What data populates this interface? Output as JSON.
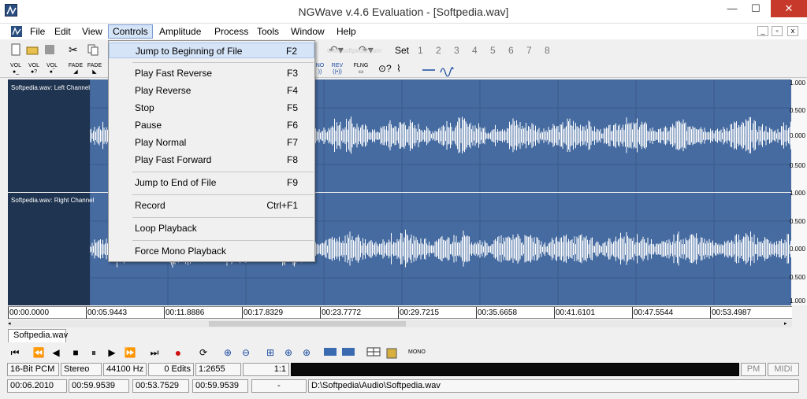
{
  "window": {
    "title": "NGWave v.4.6 Evaluation - [Softpedia.wav]",
    "minimize": "—",
    "maximize": "☐",
    "close": "✕"
  },
  "menu": [
    "File",
    "Edit",
    "View",
    "Controls",
    "Amplitude",
    "Process",
    "Tools",
    "Window",
    "Help"
  ],
  "toolbar": {
    "set_label": "Set",
    "numbers": [
      "1",
      "2",
      "3",
      "4",
      "5",
      "6",
      "7",
      "8"
    ],
    "small_labels": [
      "VOL",
      "VOL",
      "VOL",
      "FADE",
      "FADE",
      "NO",
      "REV",
      "FLNG"
    ]
  },
  "controls_menu": [
    {
      "label": "Jump to Beginning of File",
      "key": "F2"
    },
    {
      "label": "Play Fast Reverse",
      "key": "F3"
    },
    {
      "label": "Play Reverse",
      "key": "F4"
    },
    {
      "label": "Stop",
      "key": "F5"
    },
    {
      "label": "Pause",
      "key": "F6"
    },
    {
      "label": "Play Normal",
      "key": "F7"
    },
    {
      "label": "Play Fast Forward",
      "key": "F8"
    },
    {
      "label": "Jump to End of File",
      "key": "F9"
    },
    {
      "label": "Record",
      "key": "Ctrl+F1"
    },
    {
      "label": "Loop Playback",
      "key": ""
    },
    {
      "label": "Force Mono Playback",
      "key": ""
    }
  ],
  "channels": [
    {
      "name": "Softpedia.wav: Left Channel"
    },
    {
      "name": "Softpedia.wav: Right Channel"
    }
  ],
  "scale": [
    "1.000",
    "0.500",
    "0.000",
    "0.500",
    "1.000"
  ],
  "timeline": [
    "00:00.0000",
    "00:05.9443",
    "00:11.8886",
    "00:17.8329",
    "00:23.7772",
    "00:29.7215",
    "00:35.6658",
    "00:41.6101",
    "00:47.5544",
    "00:53.4987"
  ],
  "tab": "Softpedia.wav",
  "status1": {
    "bits": "16-Bit PCM",
    "mode": "Stereo",
    "rate": "44100 Hz",
    "edits": "0 Edits",
    "ratio": "1:2655",
    "zoom": "1:1",
    "pm": "PM",
    "midi": "MIDI"
  },
  "status2": {
    "pos": "00:06.2010",
    "len": "00:59.9539",
    "sel": "00:53.7529",
    "total": "00:59.9539",
    "dash": "-",
    "path": "D:\\Softpedia\\Audio\\Softpedia.wav"
  },
  "watermark": "www.softpedia.com",
  "colors": {
    "wave_bg": "#466ba0",
    "label_bg": "#1f3450",
    "menu_highlight": "#d5e4f7"
  }
}
